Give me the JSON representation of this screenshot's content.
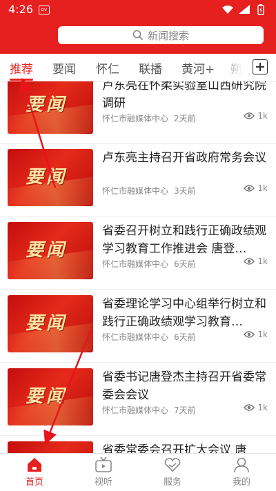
{
  "status_bar": {
    "time": "4:26",
    "notification_badge": "ᴅᴠ"
  },
  "header": {
    "search_placeholder": "新闻搜索"
  },
  "tabs": [
    {
      "label": "推荐",
      "active": true
    },
    {
      "label": "要闻",
      "active": false
    },
    {
      "label": "怀仁",
      "active": false
    },
    {
      "label": "联播",
      "active": false
    },
    {
      "label": "黄河+",
      "active": false
    },
    {
      "label": "朔州",
      "active": false
    }
  ],
  "thumb_text": "要闻",
  "news": [
    {
      "title": "卢东亮在怀柔实验室山西研究院调研",
      "source": "怀仁市融媒体中心",
      "time": "2天前",
      "views": "1k"
    },
    {
      "title": "卢东亮主持召开省政府常务会议",
      "source": "怀仁市融媒体中心",
      "time": "3天前",
      "views": "1k"
    },
    {
      "title": "省委召开树立和践行正确政绩观学习教育工作推进会 唐登…",
      "source": "怀仁市融媒体中心",
      "time": "6天前",
      "views": "1k"
    },
    {
      "title": "省委理论学习中心组举行树立和践行正确政绩观学习教育…",
      "source": "怀仁市融媒体中心",
      "time": "6天前",
      "views": "1k"
    },
    {
      "title": "省委书记唐登杰主持召开省委常委会会议",
      "source": "怀仁市融媒体中心",
      "time": "7天前",
      "views": "1k"
    },
    {
      "title": "省委常委会召开扩大会议 唐登…",
      "source": "",
      "time": "",
      "views": ""
    }
  ],
  "bottom_nav": [
    {
      "label": "首页",
      "active": true
    },
    {
      "label": "视听",
      "active": false
    },
    {
      "label": "服务",
      "active": false
    },
    {
      "label": "我的",
      "active": false
    }
  ],
  "colors": {
    "brand_red": "#e61f1f",
    "annotation_arrow": "#e8141c"
  }
}
